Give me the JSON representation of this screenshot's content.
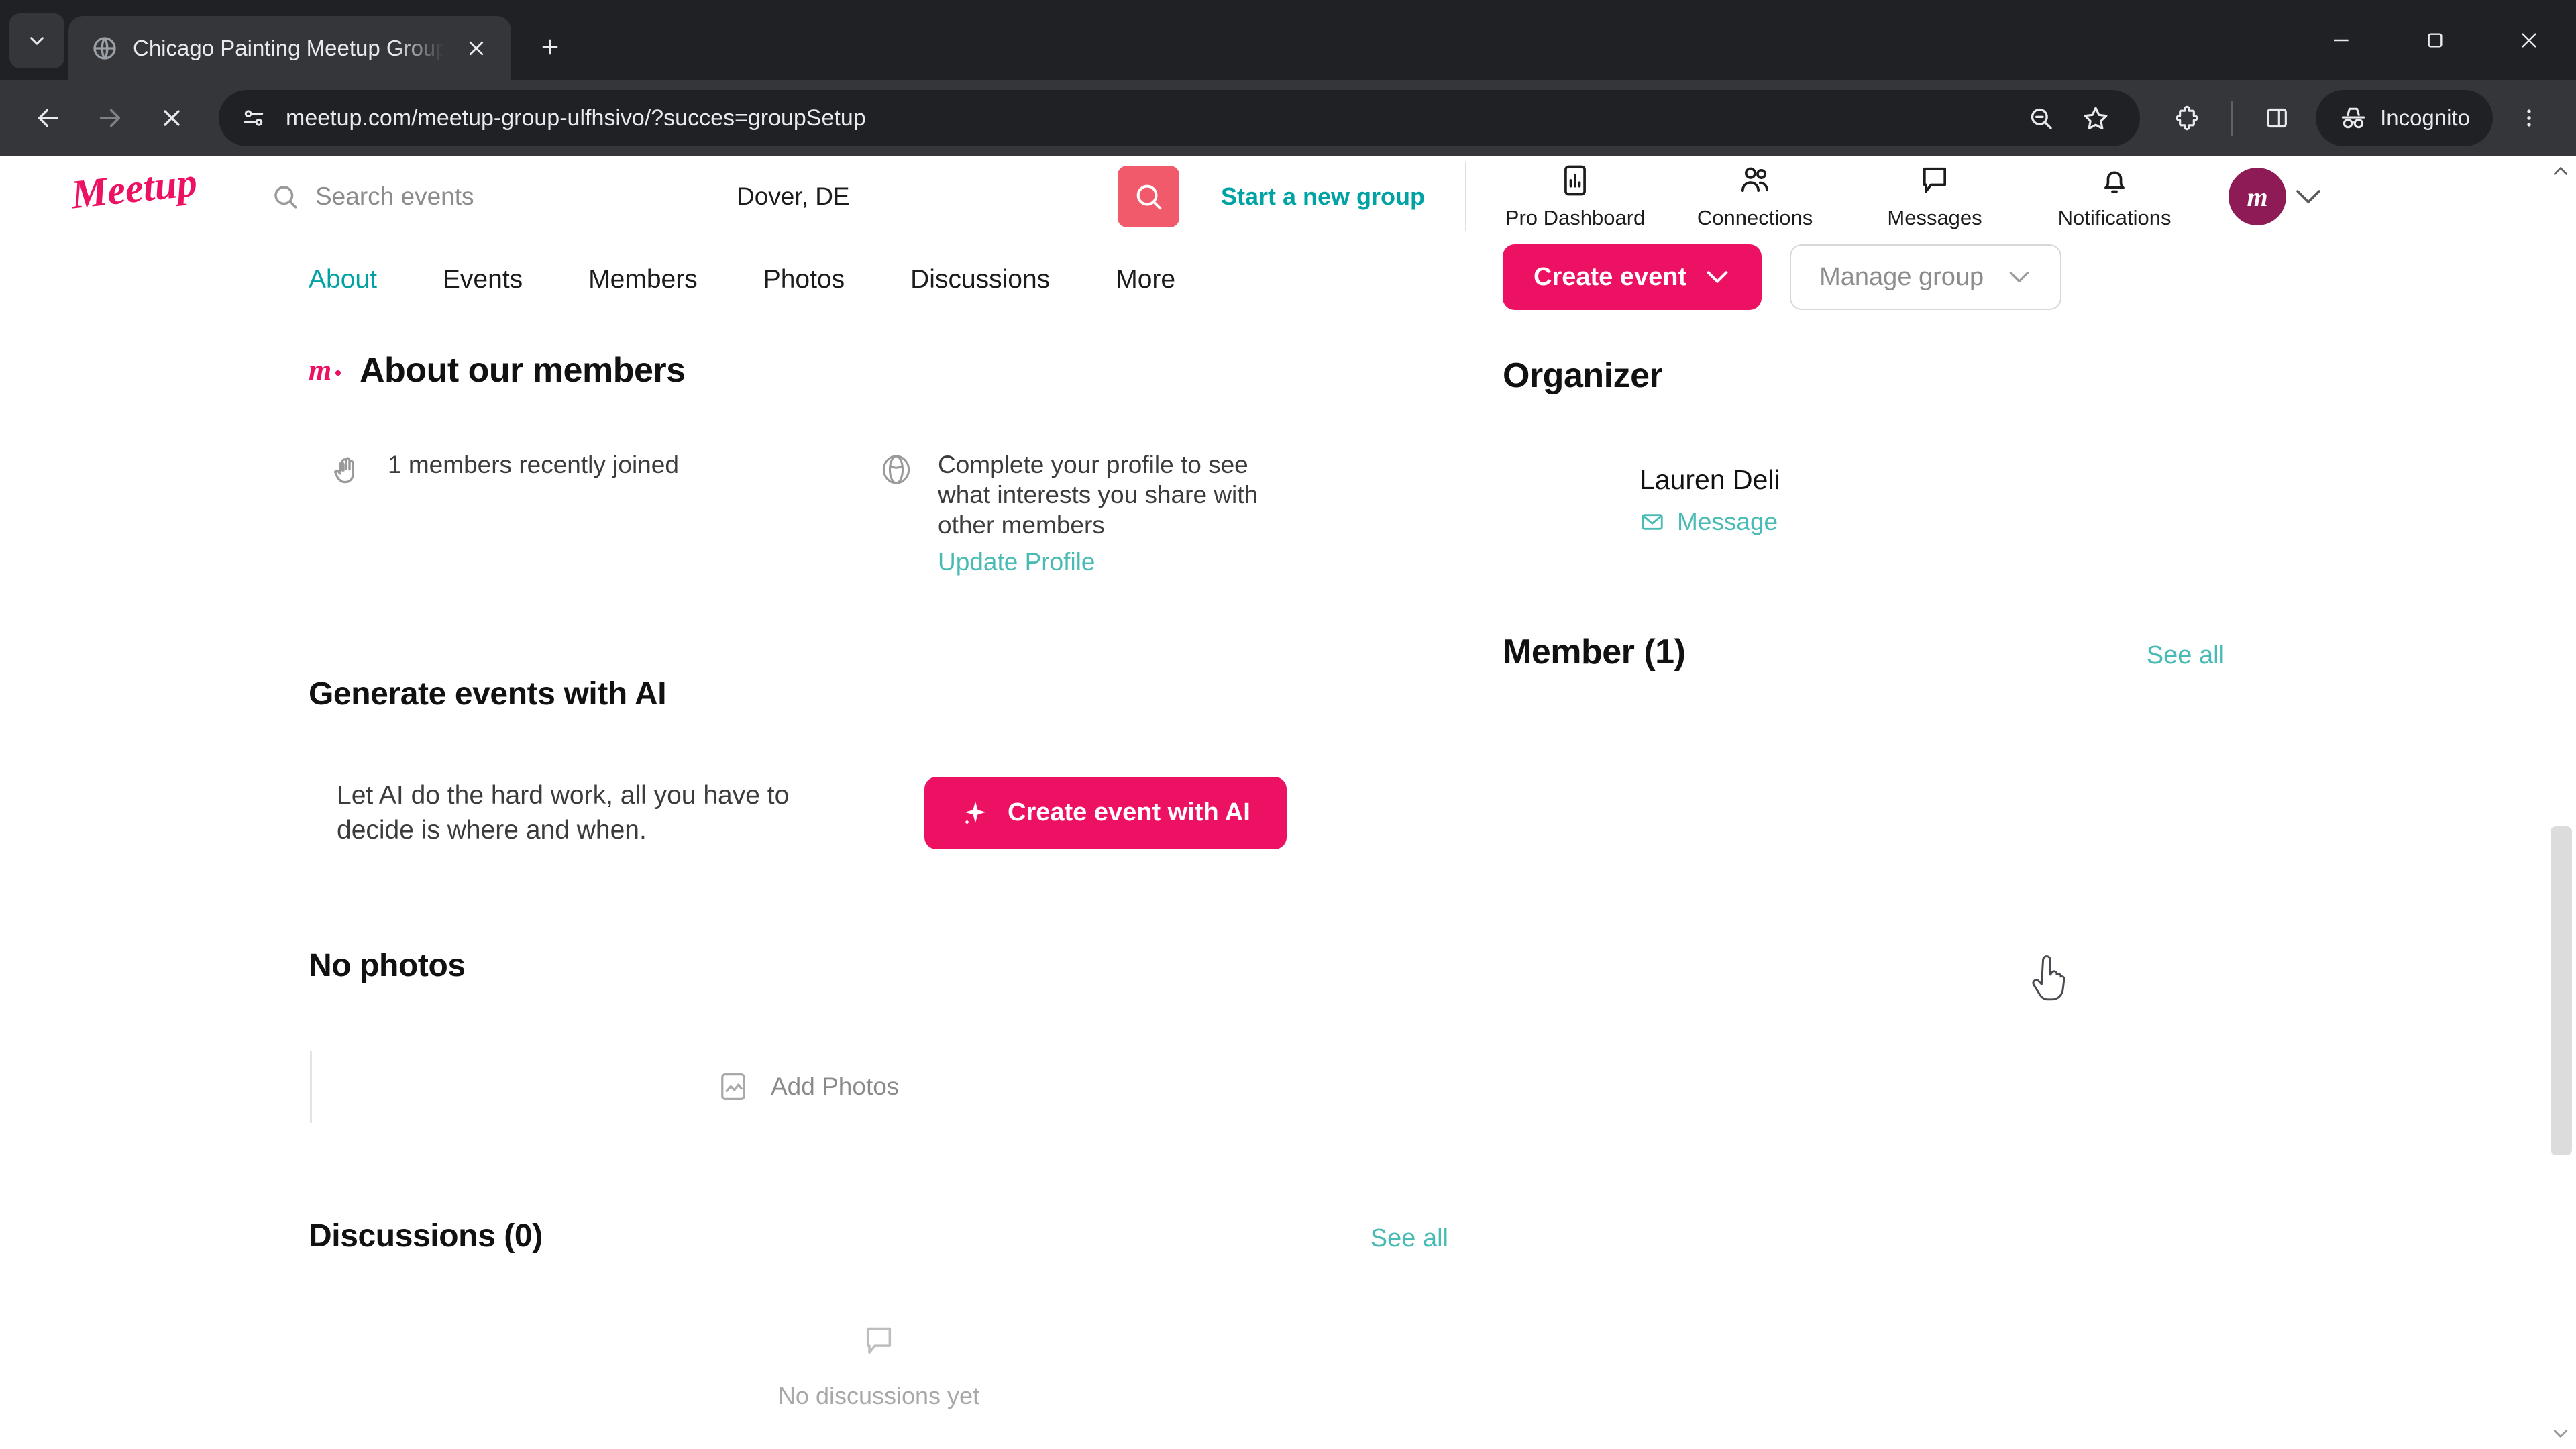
{
  "browser": {
    "tab": {
      "title": "Chicago Painting Meetup Group",
      "favicon": "globe-icon"
    },
    "new_tab_label": "+",
    "omnibox": {
      "url": "meetup.com/meetup-group-ulfhsivo/?succes=groupSetup",
      "site_info_icon": "site-settings-icon"
    },
    "profile_pill": "Incognito",
    "window": {
      "minimize": "minimize",
      "maximize": "maximize",
      "close": "close"
    }
  },
  "header": {
    "logo_alt": "Meetup",
    "search": {
      "placeholder": "Search events",
      "value": ""
    },
    "location": {
      "placeholder": "Location",
      "value": "Dover, DE"
    },
    "search_button": "search-icon",
    "start_group_label": "Start a new group",
    "nav": [
      {
        "label": "Pro Dashboard",
        "icon": "chart-bar-icon"
      },
      {
        "label": "Connections",
        "icon": "people-icon"
      },
      {
        "label": "Messages",
        "icon": "chat-bubble-icon"
      },
      {
        "label": "Notifications",
        "icon": "bell-icon"
      }
    ],
    "avatar_initial": "m"
  },
  "group": {
    "tabs": [
      {
        "label": "About",
        "active": true
      },
      {
        "label": "Events",
        "active": false
      },
      {
        "label": "Members",
        "active": false
      },
      {
        "label": "Photos",
        "active": false
      },
      {
        "label": "Discussions",
        "active": false
      },
      {
        "label": "More",
        "active": false
      }
    ],
    "actions": {
      "create_event": "Create event",
      "manage_group": "Manage group"
    }
  },
  "about_members": {
    "title": "About our members",
    "recently_joined": "1 members recently joined",
    "complete_profile": "Complete your profile to see what interests you share with other members",
    "update_profile_link": "Update Profile"
  },
  "ai_section": {
    "title": "Generate events with AI",
    "copy": "Let AI do the hard work, all you have to decide is where and when.",
    "button": "Create event with AI"
  },
  "photos_section": {
    "title": "No photos",
    "add_photos": "Add Photos"
  },
  "discussions_section": {
    "title": "Discussions (0)",
    "see_all": "See all",
    "empty": "No discussions yet"
  },
  "sidebar": {
    "organizer_title": "Organizer",
    "organizer_name": "Lauren Deli",
    "message_label": "Message",
    "member_title": "Member (1)",
    "member_see_all": "See all"
  },
  "colors": {
    "brand_pink": "#ed1164",
    "accent_teal": "#00a2a4",
    "link_teal": "#49bbb4",
    "search_button": "#f15a6a",
    "avatar": "#8e1b56"
  }
}
